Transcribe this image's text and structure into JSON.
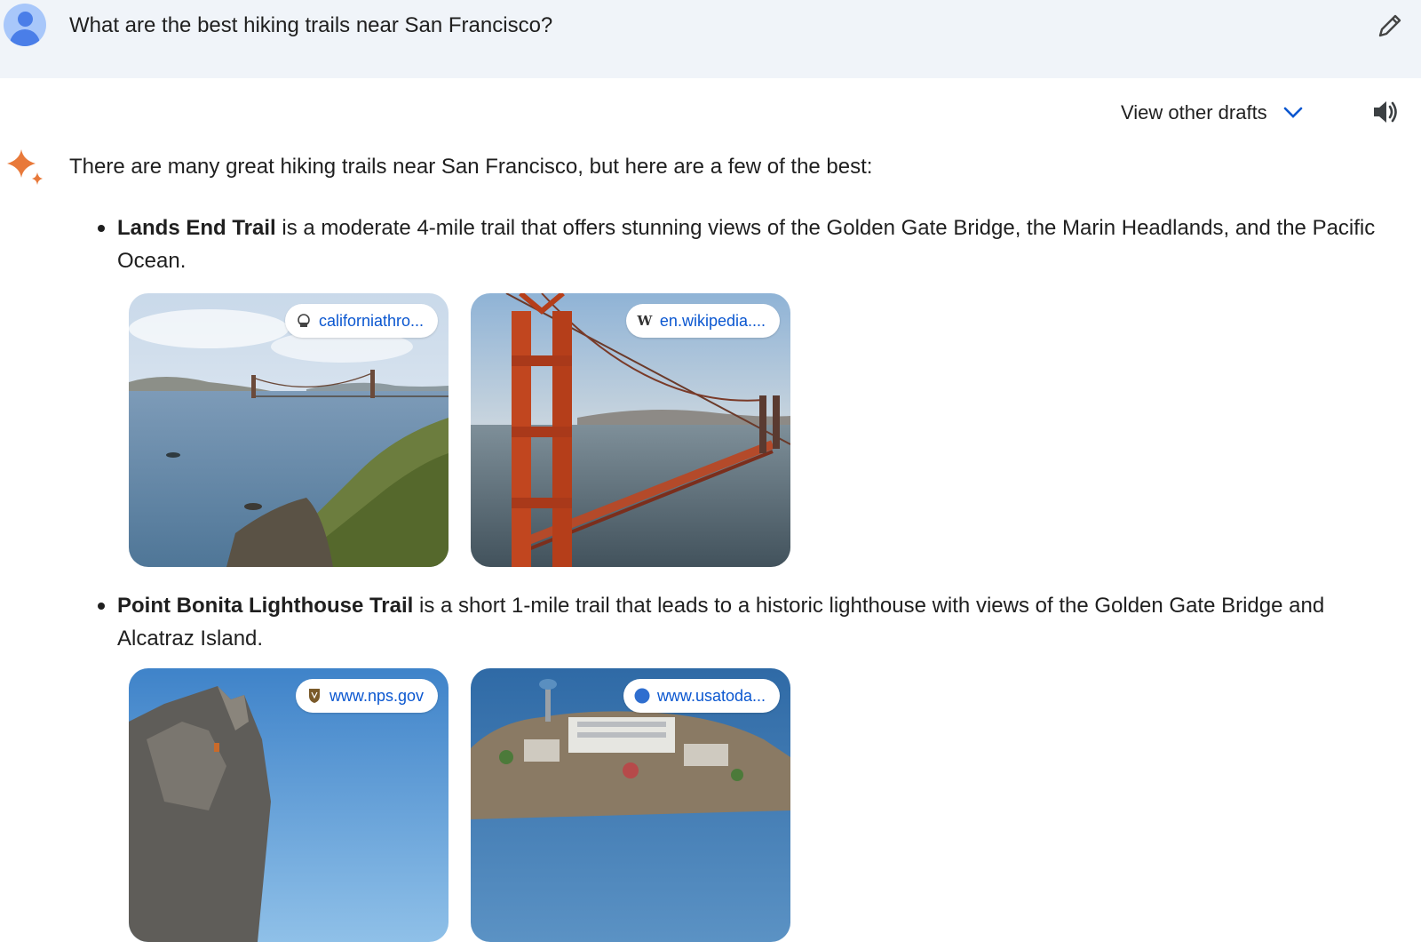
{
  "user": {
    "prompt": "What are the best hiking trails near San Francisco?",
    "avatar_icon": "user-avatar-icon",
    "edit_icon": "pencil-icon"
  },
  "toolbar": {
    "view_drafts_label": "View other drafts",
    "drafts_icon": "chevron-down-icon",
    "speaker_icon": "speaker-icon"
  },
  "response": {
    "intro": "There are many great hiking trails near San Francisco, but here are a few of the best:",
    "items": [
      {
        "title": "Lands End Trail",
        "description": " is a moderate 4-mile trail that offers stunning views of the Golden Gate Bridge, the Marin Headlands, and the Pacific Ocean.",
        "images": [
          {
            "source": "californiathro...",
            "favicon": "backpack-favicon-icon",
            "alt": "Coastal cliffs with Golden Gate Bridge in distance"
          },
          {
            "source": "en.wikipedia....",
            "favicon": "wikipedia-w-icon",
            "alt": "Golden Gate Bridge tower close up"
          }
        ]
      },
      {
        "title": "Point Bonita Lighthouse Trail",
        "description": " is a short 1-mile trail that leads to a historic lighthouse with views of the Golden Gate Bridge and Alcatraz Island.",
        "images": [
          {
            "source": "www.nps.gov",
            "favicon": "nps-shield-icon",
            "alt": "Rocky outcrop against blue sky"
          },
          {
            "source": "www.usatoda...",
            "favicon": "usatoday-circle-icon",
            "alt": "Aerial view of Alcatraz Island"
          }
        ]
      }
    ]
  },
  "colors": {
    "user_bar_bg": "#f0f4f9",
    "link_blue": "#0b57d0",
    "sparkle_orange": "#e8793a"
  }
}
